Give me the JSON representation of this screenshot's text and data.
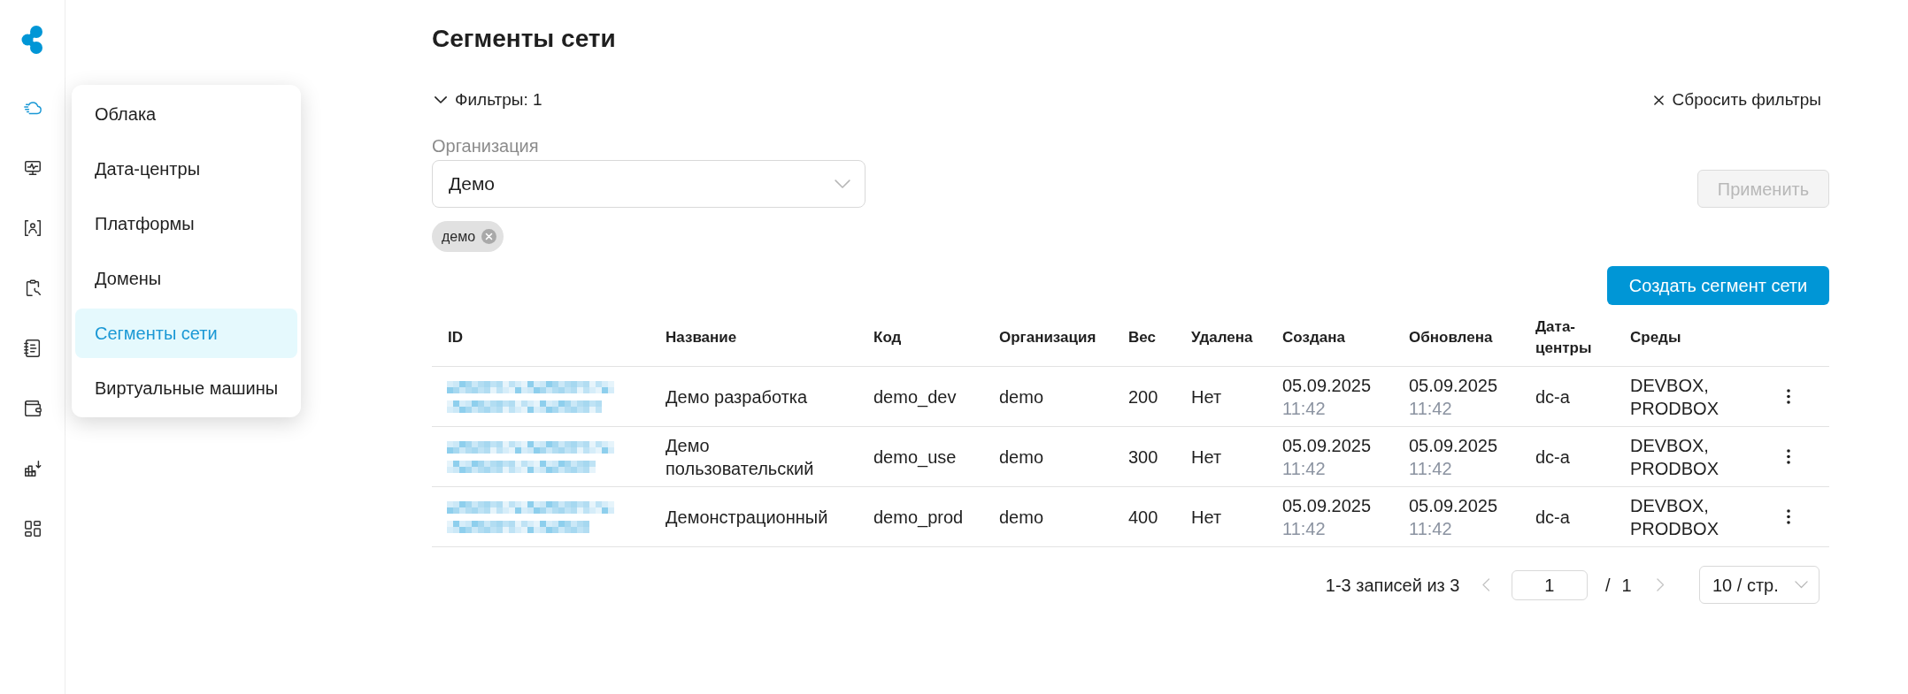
{
  "sidebar": {
    "items": [
      {
        "kind": "cloud",
        "selected": true
      },
      {
        "kind": "monitor",
        "selected": false
      },
      {
        "kind": "user_scan",
        "selected": false
      },
      {
        "kind": "clipboard",
        "selected": false
      },
      {
        "kind": "notebook",
        "selected": false
      },
      {
        "kind": "wallet",
        "selected": false
      },
      {
        "kind": "blocks",
        "selected": false
      },
      {
        "kind": "dashboard",
        "selected": false
      }
    ]
  },
  "menu": {
    "items": [
      {
        "label": "Облака",
        "selected": false
      },
      {
        "label": "Дата-центры",
        "selected": false
      },
      {
        "label": "Платформы",
        "selected": false
      },
      {
        "label": "Домены",
        "selected": false
      },
      {
        "label": "Сегменты сети",
        "selected": true
      },
      {
        "label": "Виртуальные машины",
        "selected": false
      }
    ]
  },
  "page": {
    "title": "Сегменты сети"
  },
  "filters": {
    "toggle": "Фильтры: 1",
    "expanded": true,
    "reset": "Сбросить фильтры",
    "organization": {
      "label": "Организация",
      "value": "Демо"
    },
    "tags": [
      "демо"
    ],
    "apply": {
      "label": "Применить",
      "disabled": true
    }
  },
  "create_button": {
    "label": "Создать сегмент сети"
  },
  "table": {
    "columns": [
      "ID",
      "Название",
      "Код",
      "Организация",
      "Вес",
      "Удалена",
      "Создана",
      "Обновлена",
      "Дата-центры",
      "Среды"
    ],
    "rows": [
      {
        "name": "Демо разработка",
        "code": "demo_dev",
        "organization": "demo",
        "weight": "200",
        "deleted": "Нет",
        "created": {
          "date": "05.09.2025",
          "time": "11:42"
        },
        "updated": {
          "date": "05.09.2025",
          "time": "11:42"
        },
        "datacenters": "dc-a",
        "environments": "DEVBOX, PRODBOX"
      },
      {
        "name": "Демо пользовательский",
        "code": "demo_use",
        "organization": "demo",
        "weight": "300",
        "deleted": "Нет",
        "created": {
          "date": "05.09.2025",
          "time": "11:42"
        },
        "updated": {
          "date": "05.09.2025",
          "time": "11:42"
        },
        "datacenters": "dc-a",
        "environments": "DEVBOX, PRODBOX"
      },
      {
        "name": "Демонстрационный",
        "code": "demo_prod",
        "organization": "demo",
        "weight": "400",
        "deleted": "Нет",
        "created": {
          "date": "05.09.2025",
          "time": "11:42"
        },
        "updated": {
          "date": "05.09.2025",
          "time": "11:42"
        },
        "datacenters": "dc-a",
        "environments": "DEVBOX, PRODBOX"
      }
    ]
  },
  "pagination": {
    "summary": "1-3 записей из 3",
    "prev": {
      "disabled": true
    },
    "page": "1",
    "separator": "/",
    "total": "1",
    "next": {
      "disabled": true
    },
    "page_size": "10 / стр."
  }
}
